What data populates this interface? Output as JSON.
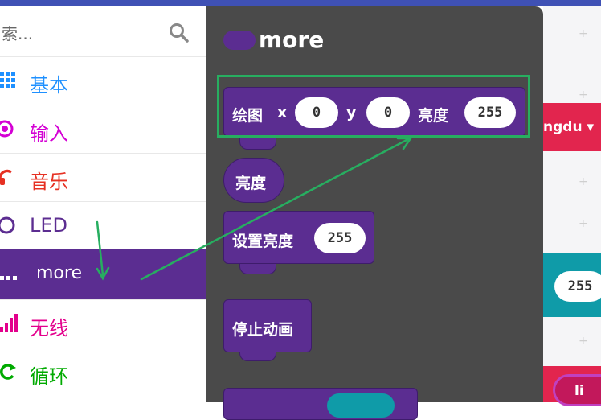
{
  "search": {
    "placeholder": "索..."
  },
  "categories": [
    {
      "label": "基本",
      "color": "#1e90ff",
      "icon": "grid-icon"
    },
    {
      "label": "输入",
      "color": "#d400d4",
      "icon": "target-icon"
    },
    {
      "label": "音乐",
      "color": "#e63022",
      "icon": "headphones-icon"
    },
    {
      "label": "LED",
      "color": "#5c2d91",
      "icon": "toggle-icon"
    },
    {
      "label": "more",
      "color": "#5b2d91",
      "icon": "dots-icon",
      "selected": true
    },
    {
      "label": "无线",
      "color": "#e3008c",
      "icon": "signal-bars-icon"
    },
    {
      "label": "循环",
      "color": "#00aa00",
      "icon": "refresh-icon"
    }
  ],
  "flyout": {
    "title": "more",
    "plot_block": {
      "label": "绘图",
      "x_label": "x",
      "x_value": "0",
      "y_label": "y",
      "y_value": "0",
      "brightness_label": "亮度",
      "brightness_value": "255"
    },
    "brightness_block": {
      "label": "亮度"
    },
    "set_brightness_block": {
      "label": "设置亮度",
      "value": "255"
    },
    "stop_animation_block": {
      "label": "停止动画"
    }
  },
  "workspace": {
    "red_block_text": "ngdu ▾",
    "teal_block_value": "255",
    "bottom_block_text": "li"
  },
  "colors": {
    "accent": "#5b2d91",
    "highlight": "#27ae60",
    "flyout_bg": "#4a4a4a",
    "topbar": "#3f51b5"
  }
}
